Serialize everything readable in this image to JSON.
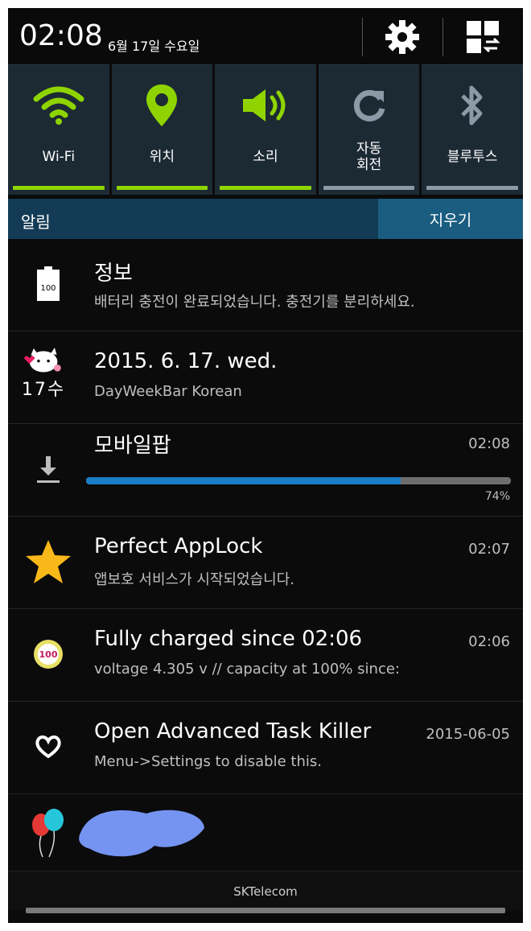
{
  "status_bar": {
    "time": "02:08",
    "date": "6월 17일 수요일",
    "settings_icon": "gear-icon",
    "quick_panel_icon": "grid-edit-icon"
  },
  "toggles": [
    {
      "label": "Wi-Fi",
      "icon": "wifi-icon",
      "state": "on"
    },
    {
      "label": "위치",
      "icon": "location-pin-icon",
      "state": "on"
    },
    {
      "label": "소리",
      "icon": "speaker-icon",
      "state": "on"
    },
    {
      "label": "자동\n회전",
      "icon": "rotate-icon",
      "state": "off"
    },
    {
      "label": "블루투스",
      "icon": "bluetooth-icon",
      "state": "off"
    }
  ],
  "notifications_header": {
    "title": "알림",
    "clear_label": "지우기"
  },
  "notifications": [
    {
      "title": "정보",
      "text": "배터리 충전이 완료되었습니다. 충전기를 분리하세요.",
      "time": "",
      "icon": "battery-full-icon",
      "battery_text": "100"
    },
    {
      "title": "2015. 6. 17. wed.",
      "text": "DayWeekBar Korean",
      "time": "",
      "icon": "cat-calendar-icon",
      "icon_text": "17수"
    },
    {
      "title": "모바일팝",
      "text": "",
      "time": "02:08",
      "icon": "download-icon",
      "progress": 74,
      "progress_label": "74%"
    },
    {
      "title": "Perfect AppLock",
      "text": "앱보호 서비스가 시작되었습니다.",
      "time": "02:07",
      "icon": "star-icon"
    },
    {
      "title": "Fully charged since 02:06",
      "text": "voltage 4.305 v // capacity at 100% since:",
      "time": "02:06",
      "icon": "battery-100-badge-icon",
      "badge_text": "100"
    },
    {
      "title": "Open Advanced Task Killer",
      "text": "Menu->Settings to disable this.",
      "time": "2015-06-05",
      "icon": "heart-icon"
    },
    {
      "title": "",
      "text": "",
      "time": "",
      "icon": "balloons-icon"
    }
  ],
  "carrier": "SKTelecom",
  "colors": {
    "toggle_on": "#8fd400",
    "toggle_off": "#8a9aa6",
    "header_bg": "#133b55",
    "clear_bg": "#1a5d80",
    "progress": "#1a7ec8"
  }
}
